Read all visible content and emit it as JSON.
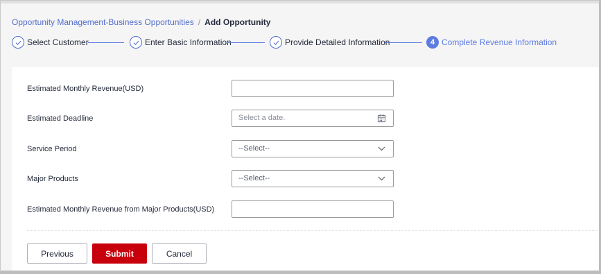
{
  "breadcrumb": {
    "parent": "Opportunity Management-Business Opportunities",
    "separator": "/",
    "current": "Add Opportunity"
  },
  "steps": [
    {
      "label": "Select Customer",
      "status": "done"
    },
    {
      "label": "Enter Basic Information",
      "status": "done"
    },
    {
      "label": "Provide Detailed Information",
      "status": "done"
    },
    {
      "label": "Complete Revenue Information",
      "status": "active",
      "number": "4"
    }
  ],
  "form": {
    "monthly_revenue": {
      "label": "Estimated Monthly Revenue(USD)",
      "value": ""
    },
    "deadline": {
      "label": "Estimated Deadline",
      "placeholder": "Select a date.",
      "icon": "calendar-icon"
    },
    "service_period": {
      "label": "Service Period",
      "selected": "--Select--"
    },
    "major_products": {
      "label": "Major Products",
      "selected": "--Select--"
    },
    "major_revenue": {
      "label": "Estimated Monthly Revenue from Major Products(USD)",
      "value": ""
    }
  },
  "actions": {
    "previous": "Previous",
    "submit": "Submit",
    "cancel": "Cancel"
  },
  "colors": {
    "accent": "#5e7ce0",
    "link": "#526ecc",
    "primary_button": "#c7000b",
    "background": "#f5f5f6"
  }
}
